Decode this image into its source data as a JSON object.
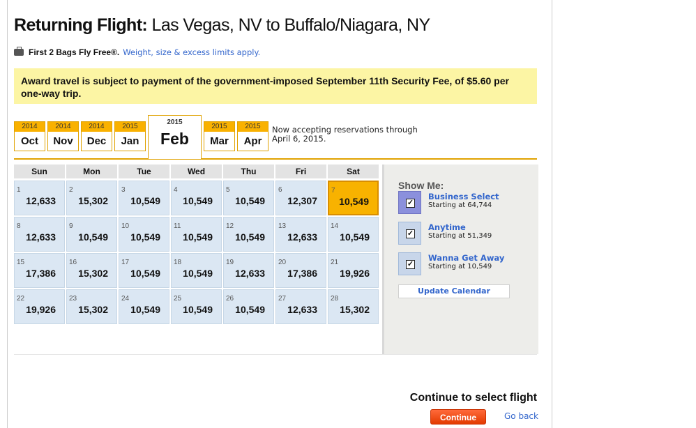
{
  "header": {
    "title_bold": "Returning Flight:",
    "title_rest": "Las Vegas, NV to Buffalo/Niagara, NY"
  },
  "bags": {
    "icon": "suitcase-icon",
    "text": "First 2 Bags Fly Free®.",
    "link": "Weight, size & excess limits apply."
  },
  "notice": "Award travel is subject to payment of the government-imposed September 11th Security Fee, of $5.60 per one-way trip.",
  "months": [
    {
      "year": "2014",
      "month": "Oct"
    },
    {
      "year": "2014",
      "month": "Nov"
    },
    {
      "year": "2014",
      "month": "Dec"
    },
    {
      "year": "2015",
      "month": "Jan"
    },
    {
      "year": "2015",
      "month": "Feb"
    },
    {
      "year": "2015",
      "month": "Mar"
    },
    {
      "year": "2015",
      "month": "Apr"
    }
  ],
  "active_month_index": 4,
  "accepting": "Now accepting reservations through April 6, 2015.",
  "calendar": {
    "days": [
      "Sun",
      "Mon",
      "Tue",
      "Wed",
      "Thu",
      "Fri",
      "Sat"
    ],
    "weeks": [
      [
        {
          "d": "1",
          "p": "12,633"
        },
        {
          "d": "2",
          "p": "15,302"
        },
        {
          "d": "3",
          "p": "10,549"
        },
        {
          "d": "4",
          "p": "10,549"
        },
        {
          "d": "5",
          "p": "10,549"
        },
        {
          "d": "6",
          "p": "12,307"
        },
        {
          "d": "7",
          "p": "10,549"
        }
      ],
      [
        {
          "d": "8",
          "p": "12,633"
        },
        {
          "d": "9",
          "p": "10,549"
        },
        {
          "d": "10",
          "p": "10,549"
        },
        {
          "d": "11",
          "p": "10,549"
        },
        {
          "d": "12",
          "p": "10,549"
        },
        {
          "d": "13",
          "p": "12,633"
        },
        {
          "d": "14",
          "p": "10,549"
        }
      ],
      [
        {
          "d": "15",
          "p": "17,386"
        },
        {
          "d": "16",
          "p": "15,302"
        },
        {
          "d": "17",
          "p": "10,549"
        },
        {
          "d": "18",
          "p": "10,549"
        },
        {
          "d": "19",
          "p": "12,633"
        },
        {
          "d": "20",
          "p": "17,386"
        },
        {
          "d": "21",
          "p": "19,926"
        }
      ],
      [
        {
          "d": "22",
          "p": "19,926"
        },
        {
          "d": "23",
          "p": "15,302"
        },
        {
          "d": "24",
          "p": "10,549"
        },
        {
          "d": "25",
          "p": "10,549"
        },
        {
          "d": "26",
          "p": "10,549"
        },
        {
          "d": "27",
          "p": "12,633"
        },
        {
          "d": "28",
          "p": "15,302"
        }
      ]
    ],
    "selected_day": "7"
  },
  "show_me": {
    "title": "Show Me:",
    "options": [
      {
        "name": "Business Select",
        "starting": "Starting at 64,744",
        "checked": true
      },
      {
        "name": "Anytime",
        "starting": "Starting at 51,349",
        "checked": true
      },
      {
        "name": "Wanna Get Away",
        "starting": "Starting at 10,549",
        "checked": true
      }
    ],
    "update_label": "Update Calendar"
  },
  "footer": {
    "continue_text": "Continue to select flight",
    "continue_button": "Continue",
    "go_back": "Go back"
  },
  "colors": {
    "accent_orange": "#f9b100",
    "link_blue": "#3366cc",
    "notice_yellow": "#fcf5a4",
    "cell_blue": "#dbe7f3",
    "continue_red": "#e33a00"
  }
}
